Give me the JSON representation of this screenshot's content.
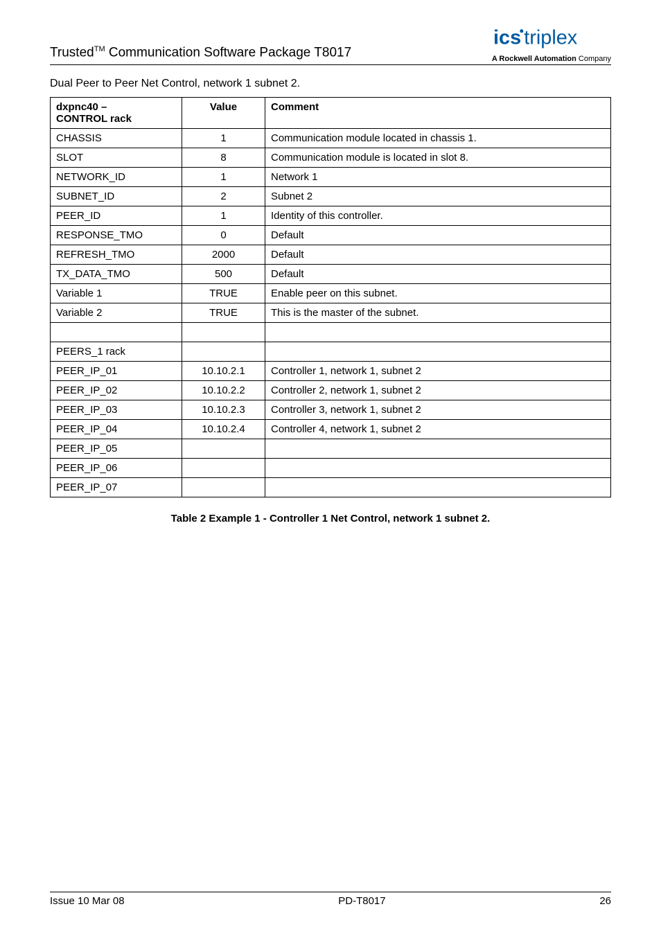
{
  "header": {
    "title_prefix": "Trusted",
    "title_tm": "TM",
    "title_suffix": " Communication Software Package T8017",
    "logo_tagline_bold": "A Rockwell Automation",
    "logo_tagline_thin": " Company"
  },
  "subhead": "Dual Peer to Peer Net Control, network 1 subnet 2.",
  "table": {
    "headers": {
      "c1a": "dxpnc40 –",
      "c1b": "CONTROL rack",
      "c2": "Value",
      "c3": "Comment"
    },
    "rows": [
      {
        "k": "CHASSIS",
        "v": "1",
        "c": "Communication module located in chassis 1."
      },
      {
        "k": "SLOT",
        "v": "8",
        "c": "Communication module is located in slot 8."
      },
      {
        "k": "NETWORK_ID",
        "v": "1",
        "c": "Network 1"
      },
      {
        "k": "SUBNET_ID",
        "v": "2",
        "c": "Subnet 2"
      },
      {
        "k": "PEER_ID",
        "v": "1",
        "c": "Identity of this controller."
      },
      {
        "k": "RESPONSE_TMO",
        "v": "0",
        "c": "Default"
      },
      {
        "k": "REFRESH_TMO",
        "v": "2000",
        "c": "Default"
      },
      {
        "k": "TX_DATA_TMO",
        "v": "500",
        "c": "Default"
      },
      {
        "k": "Variable 1",
        "v": "TRUE",
        "c": "Enable peer on this subnet."
      },
      {
        "k": "Variable 2",
        "v": "TRUE",
        "c": "This is the master of the subnet."
      },
      {
        "k": "",
        "v": "",
        "c": ""
      },
      {
        "k": "PEERS_1 rack",
        "v": "",
        "c": ""
      },
      {
        "k": "PEER_IP_01",
        "v": "10.10.2.1",
        "c": "Controller 1, network 1, subnet 2"
      },
      {
        "k": "PEER_IP_02",
        "v": "10.10.2.2",
        "c": "Controller 2, network 1, subnet 2"
      },
      {
        "k": "PEER_IP_03",
        "v": "10.10.2.3",
        "c": "Controller 3, network 1, subnet 2"
      },
      {
        "k": "PEER_IP_04",
        "v": "10.10.2.4",
        "c": "Controller 4, network 1, subnet 2"
      },
      {
        "k": "PEER_IP_05",
        "v": "",
        "c": ""
      },
      {
        "k": "PEER_IP_06",
        "v": "",
        "c": ""
      },
      {
        "k": "PEER_IP_07",
        "v": "",
        "c": ""
      }
    ]
  },
  "caption": "Table 2 Example 1 - Controller 1 Net Control, network 1 subnet 2.",
  "footer": {
    "left": "Issue 10 Mar 08",
    "center": "PD-T8017",
    "right": "26"
  }
}
